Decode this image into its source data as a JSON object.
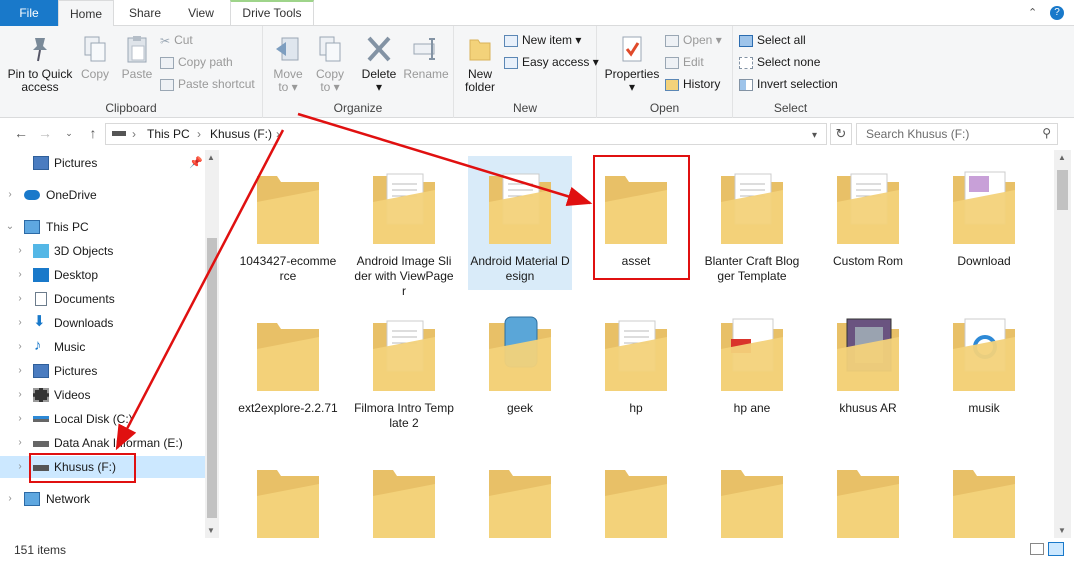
{
  "tabs": {
    "file": "File",
    "home": "Home",
    "share": "Share",
    "view": "View",
    "drive_tools": "Drive Tools"
  },
  "ribbon": {
    "clipboard": {
      "label": "Clipboard",
      "pin": [
        "Pin to Quick",
        "access"
      ],
      "copy": "Copy",
      "paste": "Paste",
      "cut": "Cut",
      "copy_path": "Copy path",
      "paste_shortcut": "Paste shortcut"
    },
    "organize": {
      "label": "Organize",
      "move_to": [
        "Move",
        "to"
      ],
      "copy_to": [
        "Copy",
        "to"
      ],
      "delete": "Delete",
      "rename": "Rename"
    },
    "new": {
      "label": "New",
      "new_folder": [
        "New",
        "folder"
      ],
      "new_item": "New item",
      "easy_access": "Easy access"
    },
    "open": {
      "label": "Open",
      "properties": "Properties",
      "open": "Open",
      "edit": "Edit",
      "history": "History"
    },
    "select": {
      "label": "Select",
      "select_all": "Select all",
      "select_none": "Select none",
      "invert_selection": "Invert selection"
    }
  },
  "address": {
    "this_pc": "This PC",
    "drive": "Khusus (F:)",
    "search_placeholder": "Search Khusus (F:)"
  },
  "nav": {
    "pictures_pinned": "Pictures",
    "onedrive": "OneDrive",
    "this_pc": "This PC",
    "objects3d": "3D Objects",
    "desktop": "Desktop",
    "documents": "Documents",
    "downloads": "Downloads",
    "music": "Music",
    "pictures": "Pictures",
    "videos": "Videos",
    "local_disk": "Local Disk (C:)",
    "data_anak": "Data Anak Informan (E:)",
    "khusus": "Khusus (F:)",
    "network": "Network"
  },
  "files": [
    {
      "name": "1043427-ecommerce",
      "selected": false,
      "highlighted": false
    },
    {
      "name": "Android Image Slider with ViewPager",
      "selected": false,
      "highlighted": false
    },
    {
      "name": "Android Material Design",
      "selected": true,
      "highlighted": false
    },
    {
      "name": "asset",
      "selected": false,
      "highlighted": true
    },
    {
      "name": "Blanter Craft Blogger Template",
      "selected": false,
      "highlighted": false
    },
    {
      "name": "Custom Rom",
      "selected": false,
      "highlighted": false
    },
    {
      "name": "Download",
      "selected": false,
      "highlighted": false
    },
    {
      "name": "ext2explore-2.2.71",
      "selected": false,
      "highlighted": false
    },
    {
      "name": "Filmora Intro Template 2",
      "selected": false,
      "highlighted": false
    },
    {
      "name": "geek",
      "selected": false,
      "highlighted": false
    },
    {
      "name": "hp",
      "selected": false,
      "highlighted": false
    },
    {
      "name": "hp ane",
      "selected": false,
      "highlighted": false
    },
    {
      "name": "khusus AR",
      "selected": false,
      "highlighted": false
    },
    {
      "name": "musik",
      "selected": false,
      "highlighted": false
    }
  ],
  "status": {
    "count": "151 items"
  },
  "colors": {
    "accent": "#1979ca",
    "selection": "#cce8ff",
    "annotation": "#e01010",
    "folder": "#f3d27a"
  }
}
